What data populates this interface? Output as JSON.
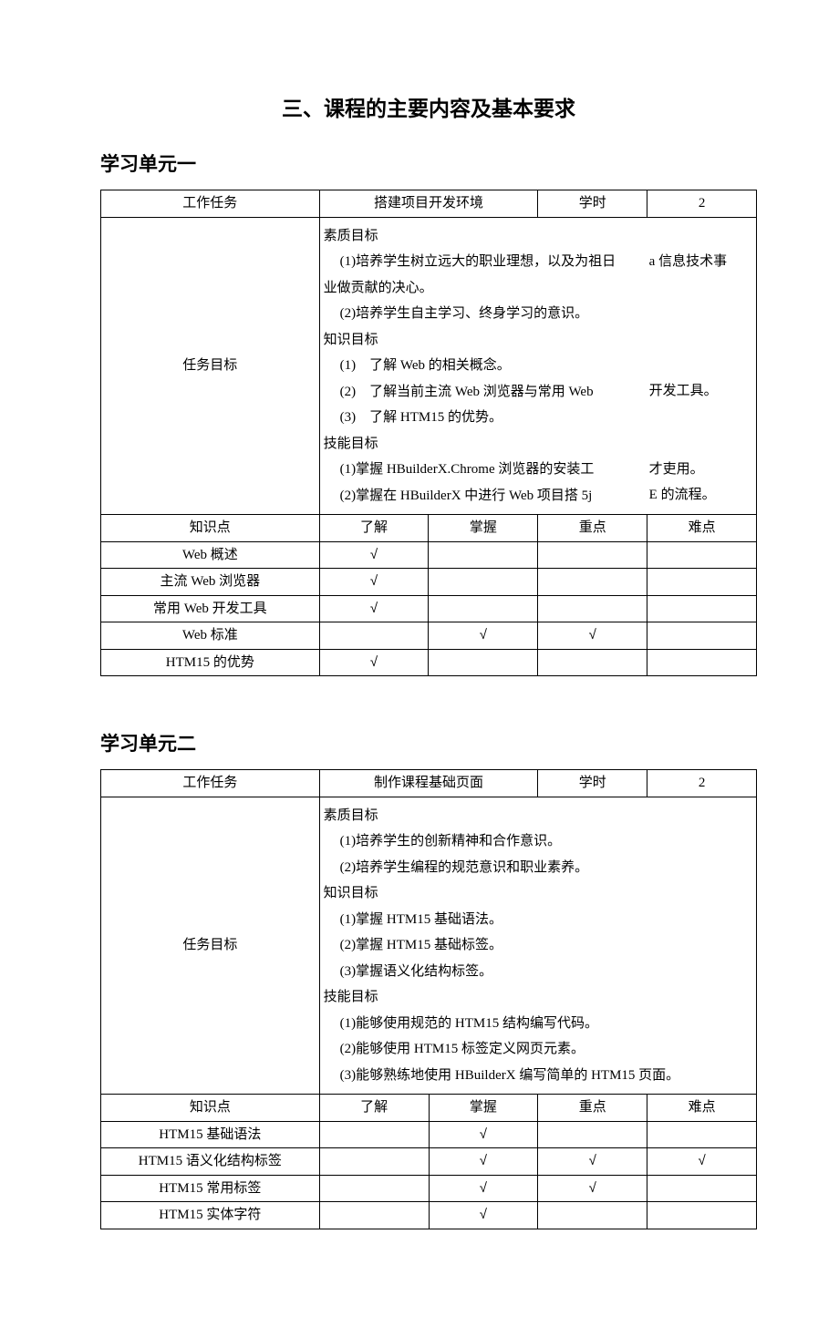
{
  "title": "三、课程的主要内容及基本要求",
  "units": [
    {
      "heading": "学习单元一",
      "taskRow": {
        "label": "工作任务",
        "name": "搭建项目开发环境",
        "hoursLabel": "学时",
        "hours": "2"
      },
      "goalsLabel": "任务目标",
      "goals": {
        "q_head": "素质目标",
        "q1": "(1)培养学生树立远大的职业理想，以及为祖日",
        "q1b": "业做贡献的决心。",
        "q2": "(2)培养学生自主学习、终身学习的意识。",
        "k_head": "知识目标",
        "k1": "(1)　了解 Web 的相关概念。",
        "k2": "(2)　了解当前主流 Web 浏览器与常用 Web",
        "k3": "(3)　了解 HTM15 的优势。",
        "s_head": "技能目标",
        "s1": "(1)掌握 HBuilderX.Chrome 浏览器的安装工",
        "s2": "(2)掌握在 HBuilderX 中进行 Web 项目搭 5j",
        "right_top": "a 信息技术事",
        "right_k2": "开发工具。",
        "right_s1": "才吏用。",
        "right_s2": "E 的流程。"
      },
      "kpHeader": {
        "c1": "知识点",
        "c2": "了解",
        "c3": "掌握",
        "c4": "重点",
        "c5": "难点"
      },
      "kpRows": [
        {
          "name": "Web 概述",
          "c2": "√",
          "c3": "",
          "c4": "",
          "c5": ""
        },
        {
          "name": "主流 Web 浏览器",
          "c2": "√",
          "c3": "",
          "c4": "",
          "c5": ""
        },
        {
          "name": "常用 Web 开发工具",
          "c2": "√",
          "c3": "",
          "c4": "",
          "c5": ""
        },
        {
          "name": "Web 标准",
          "c2": "",
          "c3": "√",
          "c4": "√",
          "c5": ""
        },
        {
          "name": "HTM15 的优势",
          "c2": "√",
          "c3": "",
          "c4": "",
          "c5": ""
        }
      ]
    },
    {
      "heading": "学习单元二",
      "taskRow": {
        "label": "工作任务",
        "name": "制作课程基础页面",
        "hoursLabel": "学时",
        "hours": "2"
      },
      "goalsLabel": "任务目标",
      "goals": {
        "q_head": "素质目标",
        "q1": "(1)培养学生的创新精神和合作意识。",
        "q2": "(2)培养学生编程的规范意识和职业素养。",
        "k_head": "知识目标",
        "k1": "(1)掌握 HTM15 基础语法。",
        "k2": "(2)掌握 HTM15 基础标签。",
        "k3": "(3)掌握语义化结构标签。",
        "s_head": "技能目标",
        "s1": "(1)能够使用规范的 HTM15 结构编写代码。",
        "s2": "(2)能够使用 HTM15 标签定义网页元素。",
        "s3": "(3)能够熟练地使用 HBuilderX 编写简单的 HTM15 页面。"
      },
      "kpHeader": {
        "c1": "知识点",
        "c2": "了解",
        "c3": "掌握",
        "c4": "重点",
        "c5": "难点"
      },
      "kpRows": [
        {
          "name": "HTM15 基础语法",
          "c2": "",
          "c3": "√",
          "c4": "",
          "c5": ""
        },
        {
          "name": "HTM15 语义化结构标签",
          "c2": "",
          "c3": "√",
          "c4": "√",
          "c5": "√"
        },
        {
          "name": "HTM15 常用标签",
          "c2": "",
          "c3": "√",
          "c4": "√",
          "c5": ""
        },
        {
          "name": "HTM15 实体字符",
          "c2": "",
          "c3": "√",
          "c4": "",
          "c5": ""
        }
      ]
    }
  ]
}
